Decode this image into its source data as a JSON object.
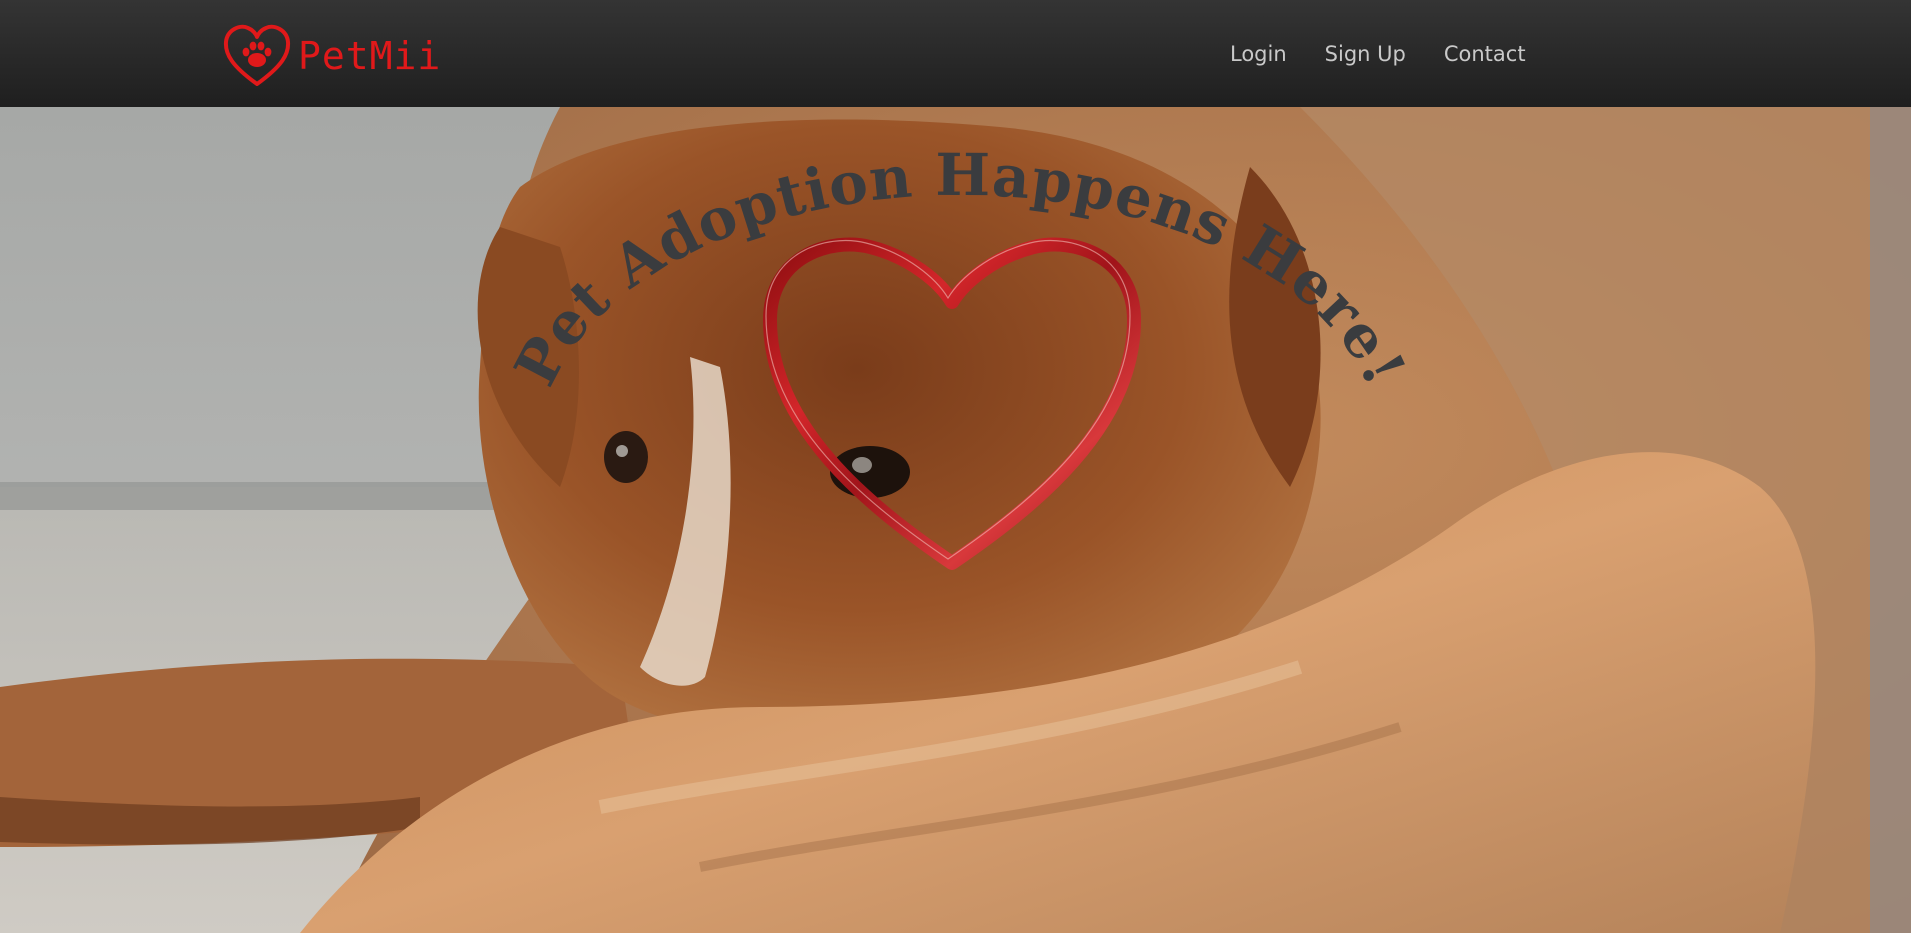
{
  "header": {
    "brand": "PetMii",
    "nav": [
      {
        "label": "Login"
      },
      {
        "label": "Sign Up"
      },
      {
        "label": "Contact"
      }
    ]
  },
  "hero": {
    "headline": "Pet Adoption Happens Here!"
  },
  "colors": {
    "brand_red": "#e0191a",
    "nav_bg": "#2a2a2a",
    "nav_text": "#c9c9c9",
    "headline": "#3a3c3f"
  }
}
